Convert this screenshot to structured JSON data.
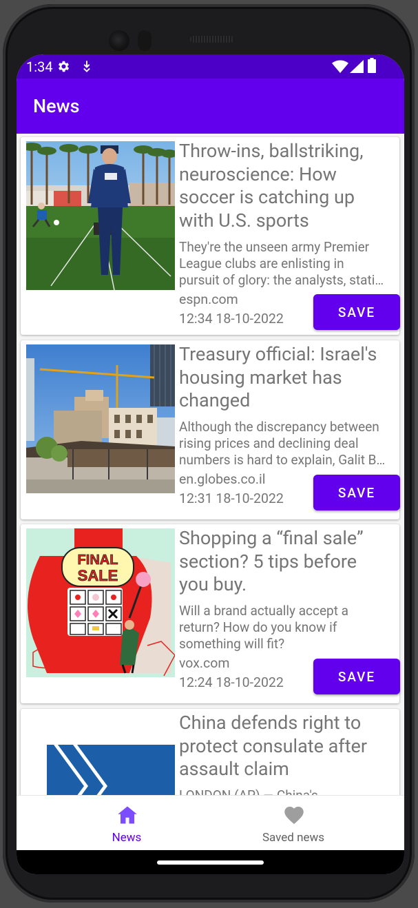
{
  "status_bar": {
    "time": "1:34"
  },
  "app_bar": {
    "title": "News"
  },
  "articles": [
    {
      "title_lines": [
        "Throw-ins, ballstriking,",
        "neuroscience: How",
        "soccer is catching up",
        "with U.S. sports"
      ],
      "desc_lines": [
        "They're the unseen army Premier",
        "League clubs are enlisting in",
        "pursuit of glory: the analysts, stati…"
      ],
      "source": "espn.com",
      "date": "12:34 18-10-2022",
      "save_label": "SAVE"
    },
    {
      "title_lines": [
        "Treasury official: Israel's",
        "housing market has",
        "changed"
      ],
      "desc_lines": [
        "Although the discrepancy between",
        "rising prices and declining deal",
        "numbers is hard to explain, Galit B…"
      ],
      "source": "en.globes.co.il",
      "date": "12:31 18-10-2022",
      "save_label": "SAVE"
    },
    {
      "title_lines": [
        "Shopping a “final sale”",
        "section? 5 tips before",
        "you buy."
      ],
      "desc_lines": [
        "Will a brand actually accept a",
        "return? How do you know if",
        "something will fit?"
      ],
      "source": "vox.com",
      "date": "12:24 18-10-2022",
      "save_label": "SAVE",
      "image_text": [
        "FINAL",
        "SALE"
      ]
    },
    {
      "title_lines": [
        "China defends right to",
        "protect consulate after",
        "assault claim"
      ],
      "desc_lines": [
        "LONDON (AP) — China's"
      ]
    }
  ],
  "bottom_nav": {
    "items": [
      {
        "label": "News",
        "icon": "home-icon",
        "active": true
      },
      {
        "label": "Saved news",
        "icon": "heart-icon",
        "active": false
      }
    ],
    "active_color": "#6200ee",
    "inactive_color": "#616161"
  },
  "colors": {
    "app_bar": "#6200ee",
    "status_bar": "#4c00c7",
    "button": "#6200ee",
    "text_secondary": "#757575"
  }
}
